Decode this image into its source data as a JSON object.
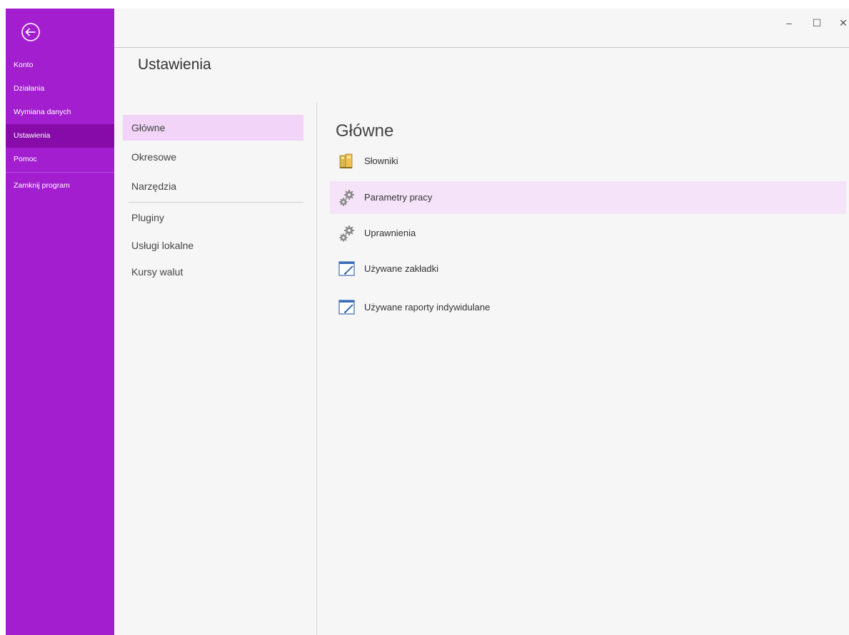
{
  "rail": {
    "items": [
      {
        "label": "Konto"
      },
      {
        "label": "Działania"
      },
      {
        "label": "Wymiana danych"
      },
      {
        "label": "Ustawienia",
        "active": true
      },
      {
        "label": "Pomoc"
      },
      {
        "label": "Zamknij program"
      }
    ]
  },
  "window_controls": {
    "minimize": "–",
    "maximize": "☐",
    "close": "✕"
  },
  "page": {
    "title": "Ustawienia"
  },
  "nav": {
    "items": [
      {
        "label": "Główne",
        "active": true
      },
      {
        "label": "Okresowe"
      },
      {
        "label": "Narzędzia"
      },
      {
        "label": "Pluginy"
      },
      {
        "label": "Usługi lokalne"
      },
      {
        "label": "Kursy walut"
      }
    ]
  },
  "content": {
    "title": "Główne",
    "items": [
      {
        "label": "Słowniki",
        "icon": "books-icon"
      },
      {
        "label": "Parametry pracy",
        "icon": "gears-icon",
        "highlighted": true
      },
      {
        "label": "Uprawnienia",
        "icon": "gears-icon"
      },
      {
        "label": "Używane zakładki",
        "icon": "edit-window-icon"
      },
      {
        "label": "Używane raporty indywidulane",
        "icon": "edit-window-icon"
      }
    ]
  },
  "colors": {
    "rail": "#a21ecf",
    "rail_active": "#870ba8",
    "nav_active": "#f2d4f8",
    "content_highlight": "#f5e4f9"
  }
}
